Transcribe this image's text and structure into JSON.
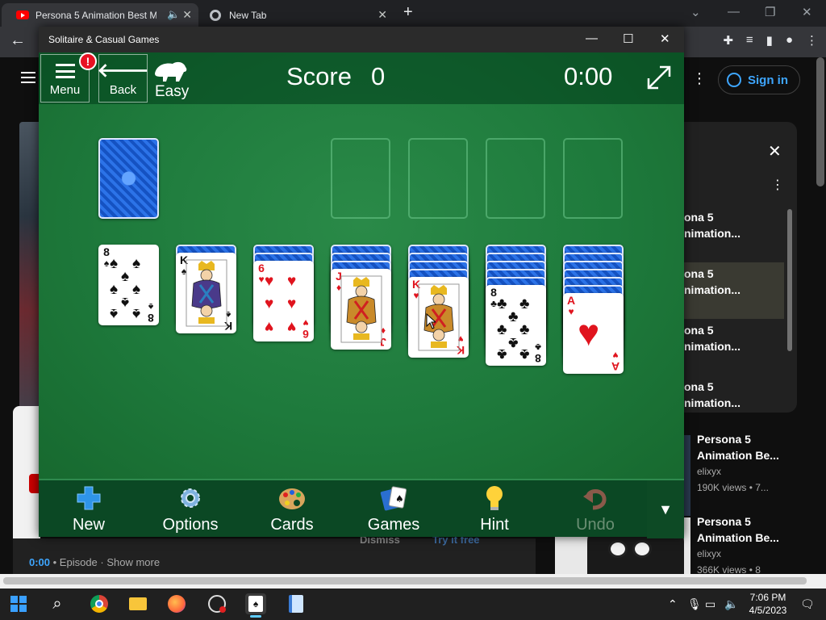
{
  "browser": {
    "tabs": [
      {
        "label": "Persona 5 Animation Best M",
        "muted_icon": "speaker-icon"
      },
      {
        "label": "New Tab"
      }
    ],
    "new_tab_symbol": "+",
    "window_controls": [
      "⌄",
      "—",
      "❐",
      "✕"
    ]
  },
  "youtube": {
    "signin": "Sign in",
    "playlist": {
      "items": [
        {
          "line1": "ona 5",
          "line2": "nimation...",
          "selected": false
        },
        {
          "line1": "ona 5",
          "line2": "nimation...",
          "selected": true
        },
        {
          "line1": "ona 5",
          "line2": "nimation...",
          "selected": false
        },
        {
          "line1": "ona 5",
          "line2": "nimation...",
          "selected": false
        }
      ]
    },
    "recommendations": [
      {
        "title1": "Persona 5",
        "title2": "Animation Be...",
        "channel": "elixyx",
        "meta": "190K views  • 7..."
      },
      {
        "title1": "Persona 5",
        "title2": "Animation Be...",
        "channel": "elixyx",
        "meta": "366K views  • 8"
      }
    ],
    "dismiss": "Dismiss",
    "try_free": "Try it free",
    "episode_prefix": "0:00",
    "episode_text": " • Episode  ·  Show more"
  },
  "solitaire": {
    "window_title": "Solitaire & Casual Games",
    "title_controls": [
      "—",
      "☐",
      "✕"
    ],
    "menu_label": "Menu",
    "alert_badge": "!",
    "back_label": "Back",
    "difficulty": "Easy",
    "score_label": "Score",
    "score_value": "0",
    "timer": "0:00",
    "tableau": [
      {
        "rank": "8",
        "suit": "♠",
        "color": "#111111",
        "face_down": 0
      },
      {
        "rank": "K",
        "suit": "♠",
        "color": "#111111",
        "face_down": 1
      },
      {
        "rank": "6",
        "suit": "♥",
        "color": "#e0141e",
        "face_down": 2
      },
      {
        "rank": "J",
        "suit": "♦",
        "color": "#e0141e",
        "face_down": 3
      },
      {
        "rank": "K",
        "suit": "♥",
        "color": "#e0141e",
        "face_down": 4
      },
      {
        "rank": "8",
        "suit": "♣",
        "color": "#111111",
        "face_down": 5
      },
      {
        "rank": "A",
        "suit": "♥",
        "color": "#e0141e",
        "face_down": 6
      }
    ],
    "toolbar": {
      "new": "New",
      "options": "Options",
      "cards": "Cards",
      "games": "Games",
      "hint": "Hint",
      "undo": "Undo"
    }
  },
  "taskbar": {
    "time": "7:06 PM",
    "date": "4/5/2023"
  }
}
